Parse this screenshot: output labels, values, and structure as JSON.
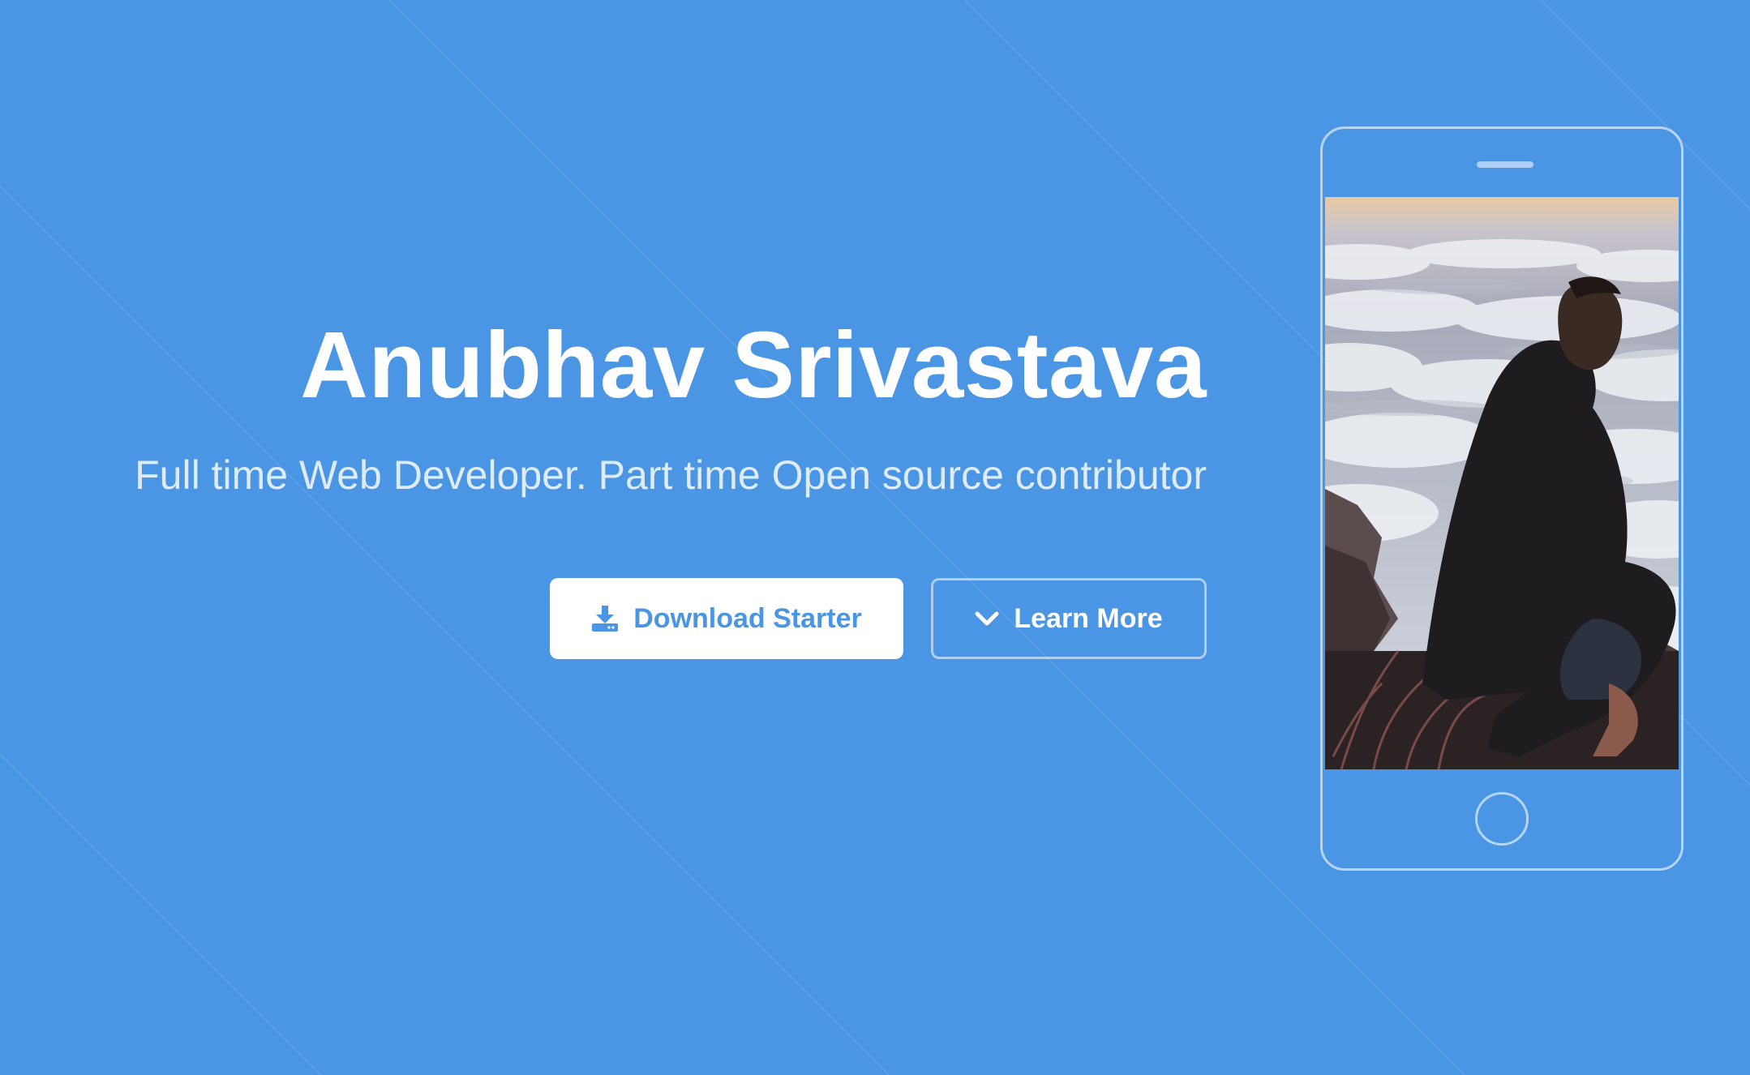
{
  "hero": {
    "title": "Anubhav Srivastava",
    "subtitle": "Full time Web Developer. Part time Open source contributor",
    "background_color": "#4a95e4",
    "primary_button": {
      "label": "Download Starter",
      "icon": "download-icon"
    },
    "secondary_button": {
      "label": "Learn More",
      "icon": "chevron-down-icon"
    }
  },
  "phone": {
    "screen_image": "man-sitting-above-clouds-photo"
  }
}
